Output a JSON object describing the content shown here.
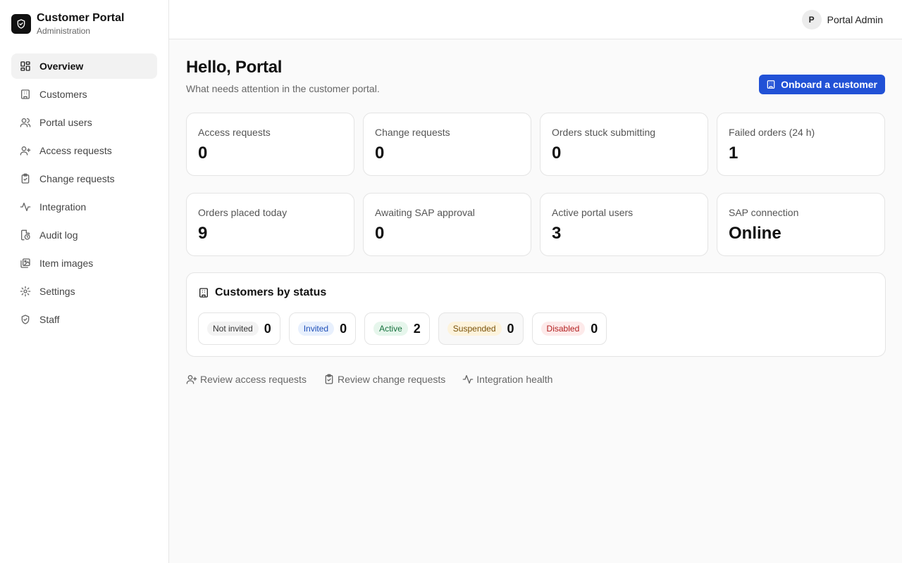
{
  "brand": {
    "title": "Customer Portal",
    "subtitle": "Administration",
    "icon": "shield-icon"
  },
  "nav": [
    {
      "label": "Overview",
      "icon": "layout-grid-icon",
      "active": true
    },
    {
      "label": "Customers",
      "icon": "building-icon"
    },
    {
      "label": "Portal users",
      "icon": "users-icon"
    },
    {
      "label": "Access requests",
      "icon": "user-plus-icon"
    },
    {
      "label": "Change requests",
      "icon": "clipboard-check-icon"
    },
    {
      "label": "Integration",
      "icon": "activity-icon"
    },
    {
      "label": "Audit log",
      "icon": "file-clock-icon"
    },
    {
      "label": "Item images",
      "icon": "images-icon"
    },
    {
      "label": "Settings",
      "icon": "gear-icon"
    },
    {
      "label": "Staff",
      "icon": "shield-icon"
    }
  ],
  "user": {
    "initial": "P",
    "name": "Portal Admin"
  },
  "header": {
    "title": "Hello, Portal",
    "subtitle": "What needs attention in the customer portal.",
    "primary_button": "Onboard a customer"
  },
  "stats": [
    {
      "label": "Access requests",
      "value": "0"
    },
    {
      "label": "Change requests",
      "value": "0"
    },
    {
      "label": "Orders stuck submitting",
      "value": "0"
    },
    {
      "label": "Failed orders (24 h)",
      "value": "1"
    },
    {
      "label": "Orders placed today",
      "value": "9"
    },
    {
      "label": "Awaiting SAP approval",
      "value": "0"
    },
    {
      "label": "Active portal users",
      "value": "3"
    },
    {
      "label": "SAP connection",
      "value": "Online"
    }
  ],
  "status_card": {
    "title": "Customers by status",
    "statuses": [
      {
        "label": "Not invited",
        "count": "0",
        "badge_bg": "#f3f3f3",
        "badge_fg": "#333333"
      },
      {
        "label": "Invited",
        "count": "0",
        "badge_bg": "#e8f0fd",
        "badge_fg": "#1e4fb8"
      },
      {
        "label": "Active",
        "count": "2",
        "badge_bg": "#e6f6ec",
        "badge_fg": "#17723e"
      },
      {
        "label": "Suspended",
        "count": "0",
        "badge_bg": "#fdf3dc",
        "badge_fg": "#7a5208"
      },
      {
        "label": "Disabled",
        "count": "0",
        "badge_bg": "#fdeaea",
        "badge_fg": "#b32020"
      }
    ]
  },
  "quick_links": [
    {
      "label": "Review access requests",
      "icon": "user-plus-icon"
    },
    {
      "label": "Review change requests",
      "icon": "clipboard-check-icon"
    },
    {
      "label": "Integration health",
      "icon": "activity-icon"
    }
  ],
  "colors": {
    "accent": "#2151d6",
    "border": "#e4e4e4",
    "background": "#fafafa"
  }
}
